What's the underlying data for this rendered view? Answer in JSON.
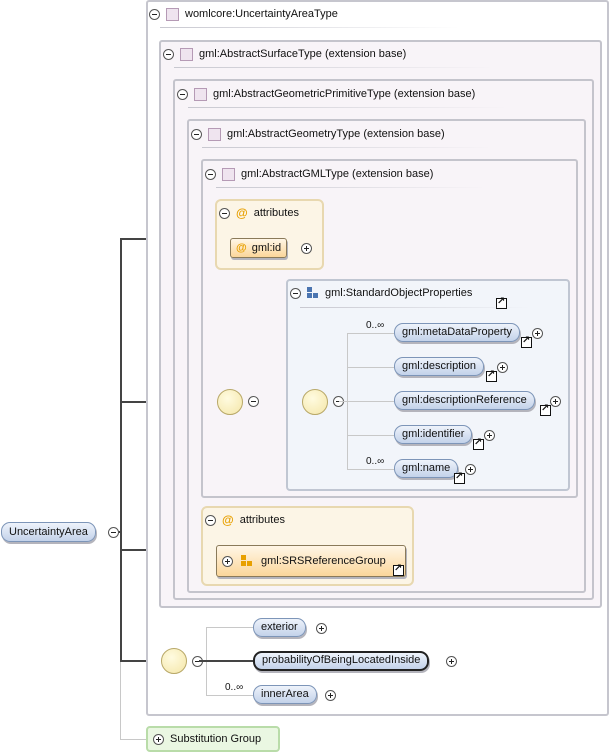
{
  "root": {
    "label": "UncertaintyArea"
  },
  "type": {
    "label": "womlcore:UncertaintyAreaType"
  },
  "bases": [
    {
      "label": "gml:AbstractSurfaceType (extension base)"
    },
    {
      "label": "gml:AbstractGeometricPrimitiveType (extension base)"
    },
    {
      "label": "gml:AbstractGeometryType (extension base)"
    },
    {
      "label": "gml:AbstractGMLType (extension base)"
    }
  ],
  "gml_attributes": {
    "header": "attributes",
    "at_symbol": "@",
    "id_label": "gml:id"
  },
  "standard_props": {
    "label": "gml:StandardObjectProperties",
    "items": [
      {
        "label": "gml:metaDataProperty",
        "occurrence": "0..∞"
      },
      {
        "label": "gml:description",
        "occurrence": ""
      },
      {
        "label": "gml:descriptionReference",
        "occurrence": ""
      },
      {
        "label": "gml:identifier",
        "occurrence": ""
      },
      {
        "label": "gml:name",
        "occurrence": "0..∞"
      }
    ]
  },
  "surface_attributes": {
    "header": "attributes",
    "at_symbol": "@",
    "group_label": "gml:SRSReferenceGroup"
  },
  "elements": [
    {
      "label": "exterior",
      "occurrence": ""
    },
    {
      "label": "probabilityOfBeingLocatedInside",
      "occurrence": ""
    },
    {
      "label": "innerArea",
      "occurrence": "0..∞"
    }
  ],
  "substitution": {
    "label": "Substitution Group"
  },
  "colors": {
    "wire": "#444444",
    "pill": "#c3d2ea",
    "attribute": "#fcf5e6",
    "substitution": "#eaf7e2"
  }
}
